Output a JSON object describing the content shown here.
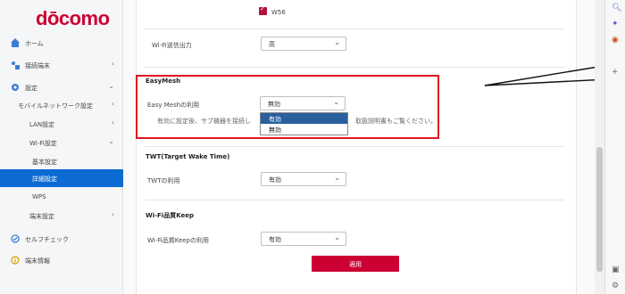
{
  "brand": {
    "logo_text": "dōcomo",
    "color": "#cc0033"
  },
  "nav": {
    "items": [
      {
        "label": "ホーム",
        "icon": "home-icon"
      },
      {
        "label": "接続端末",
        "icon": "devices-icon"
      },
      {
        "label": "設定",
        "icon": "gear-icon"
      },
      {
        "label": "モバイルネットワーク設定",
        "icon": ""
      },
      {
        "label": "LAN設定",
        "icon": ""
      },
      {
        "label": "Wi-Fi設定",
        "icon": ""
      },
      {
        "label": "基本設定",
        "icon": ""
      },
      {
        "label": "詳細設定",
        "icon": ""
      },
      {
        "label": "WPS",
        "icon": ""
      },
      {
        "label": "端末設定",
        "icon": ""
      },
      {
        "label": "セルフチェック",
        "icon": "selfcheck-icon"
      },
      {
        "label": "端末情報",
        "icon": "info-icon"
      }
    ]
  },
  "content": {
    "top_checkbox_label": "W56",
    "wifi_power": {
      "label": "Wi-Fi送信出力",
      "value": "高"
    },
    "easymesh": {
      "section": "EasyMesh",
      "label": "Easy Meshの利用",
      "value": "無効",
      "hint_left": "有効に設定後、サブ機器を接続し",
      "hint_right": "取扱説明書もご覧ください。",
      "options": [
        "有効",
        "無効"
      ]
    },
    "twt": {
      "section": "TWT(Target Wake Time)",
      "label": "TWTの利用",
      "value": "有効"
    },
    "keep": {
      "section": "Wi-Fi品質Keep",
      "label": "Wi-Fi品質Keepの利用",
      "value": "有効"
    },
    "apply_label": "適用"
  },
  "colors": {
    "accent_blue": "#0b6bd3",
    "highlight_red": "#e0141e",
    "button_red": "#cc0033"
  }
}
